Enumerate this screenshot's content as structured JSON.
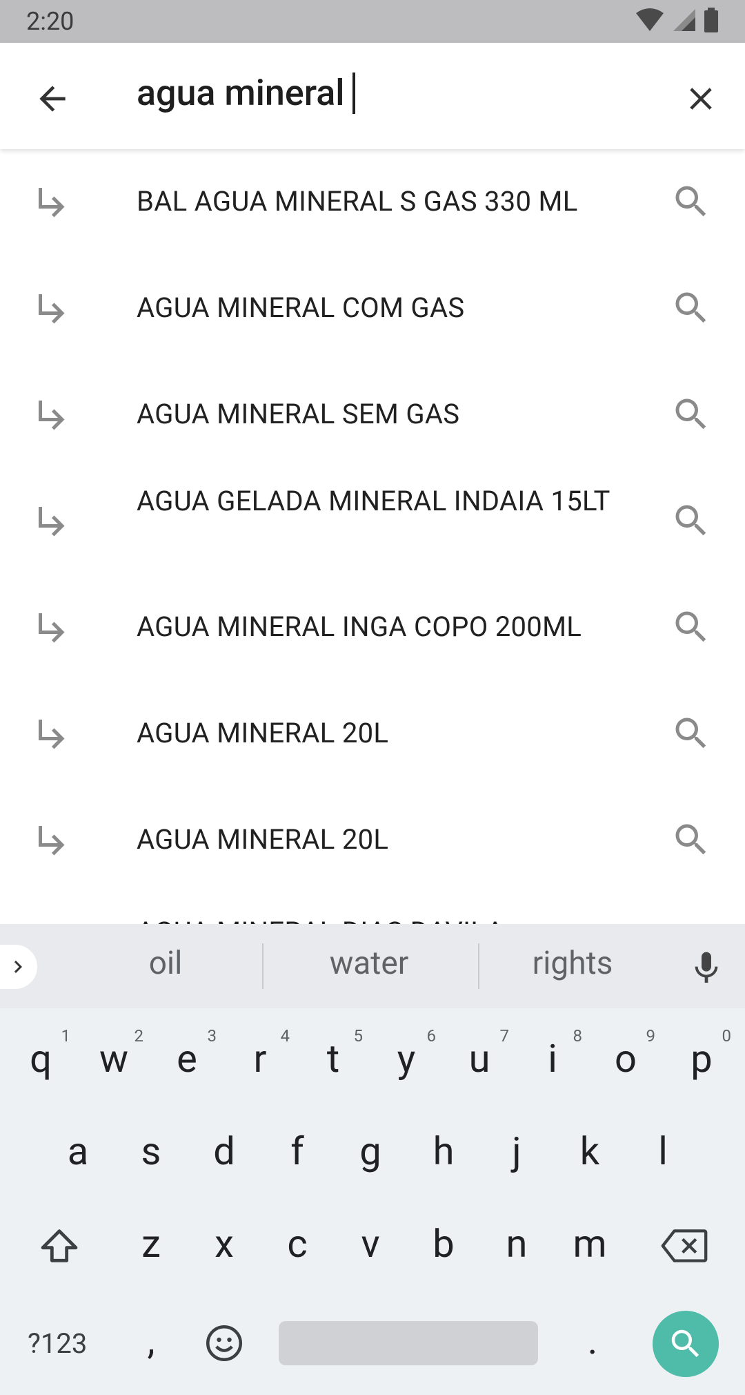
{
  "status_bar": {
    "time": "2:20"
  },
  "search": {
    "query": "agua mineral"
  },
  "suggestions": [
    "BAL AGUA MINERAL S GAS 330 ML",
    "AGUA MINERAL COM GAS",
    "AGUA MINERAL SEM GAS",
    "AGUA GELADA MINERAL INDAIA 15LT",
    "AGUA MINERAL INGA COPO 200ML",
    "AGUA MINERAL 20L",
    "AGUA MINERAL 20L",
    "AGUA MINERAL DIAS DAVILA"
  ],
  "keyboard": {
    "word_suggestions": [
      "oil",
      "water",
      "rights"
    ],
    "row1": [
      "q",
      "w",
      "e",
      "r",
      "t",
      "y",
      "u",
      "i",
      "o",
      "p"
    ],
    "row1_nums": [
      "1",
      "2",
      "3",
      "4",
      "5",
      "6",
      "7",
      "8",
      "9",
      "0"
    ],
    "row2": [
      "a",
      "s",
      "d",
      "f",
      "g",
      "h",
      "j",
      "k",
      "l"
    ],
    "row3": [
      "z",
      "x",
      "c",
      "v",
      "b",
      "n",
      "m"
    ],
    "symbols_label": "?123",
    "comma": ",",
    "period": "."
  },
  "colors": {
    "accent": "#4fbcaa",
    "status_bar": "#bdbcbe",
    "keyboard_bg": "#eef1f4"
  }
}
